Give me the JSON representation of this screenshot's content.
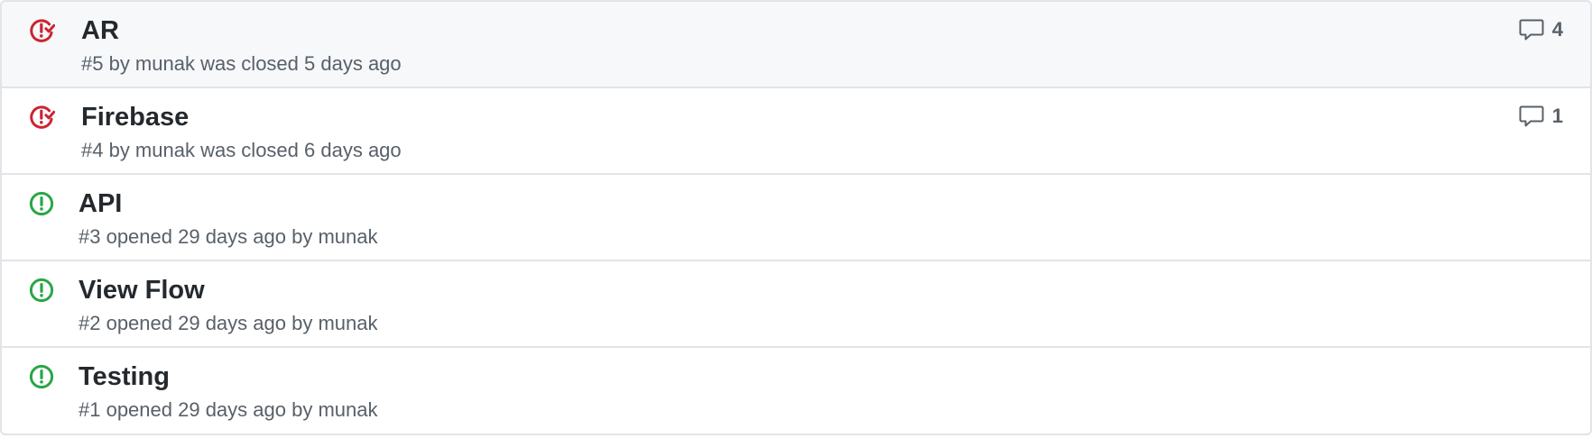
{
  "colors": {
    "closed": "#cb2431",
    "open": "#28a745",
    "border": "#e1e4e8",
    "title": "#24292e",
    "meta": "#586069",
    "row_highlight": "#f6f8fa"
  },
  "issues": [
    {
      "state": "closed",
      "icon": "issue-closed-icon",
      "title": "AR",
      "meta": "#5 by munak was closed 5 days ago",
      "comments": "4"
    },
    {
      "state": "closed",
      "icon": "issue-closed-icon",
      "title": "Firebase",
      "meta": "#4 by munak was closed 6 days ago",
      "comments": "1"
    },
    {
      "state": "open",
      "icon": "issue-opened-icon",
      "title": "API",
      "meta": "#3 opened 29 days ago by munak"
    },
    {
      "state": "open",
      "icon": "issue-opened-icon",
      "title": "View Flow",
      "meta": "#2 opened 29 days ago by munak"
    },
    {
      "state": "open",
      "icon": "issue-opened-icon",
      "title": "Testing",
      "meta": "#1 opened 29 days ago by munak"
    }
  ]
}
